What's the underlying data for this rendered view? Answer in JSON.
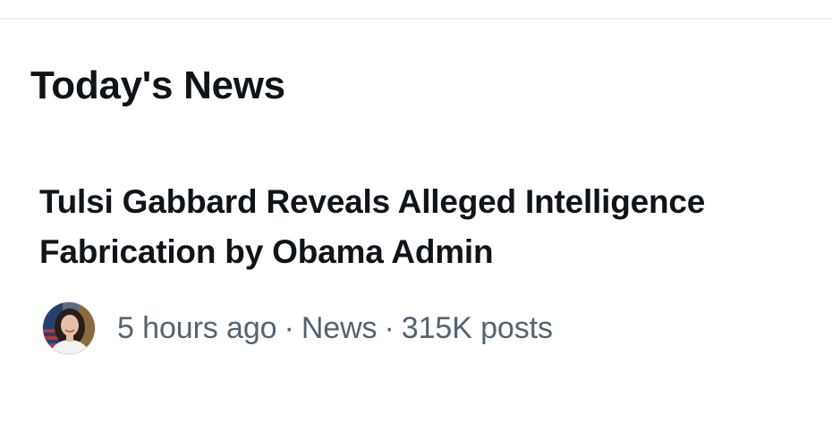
{
  "section": {
    "title": "Today's News"
  },
  "story": {
    "headline": "Tulsi Gabbard Reveals Alleged Intelligence Fabrication by Obama Admin",
    "time": "5 hours ago",
    "category": "News",
    "posts": "315K posts",
    "separator": "·",
    "avatar_icon": "person-avatar-icon"
  },
  "colors": {
    "text_primary": "#0f1419",
    "text_secondary": "#536471",
    "divider": "#eff3f4",
    "background": "#ffffff"
  }
}
